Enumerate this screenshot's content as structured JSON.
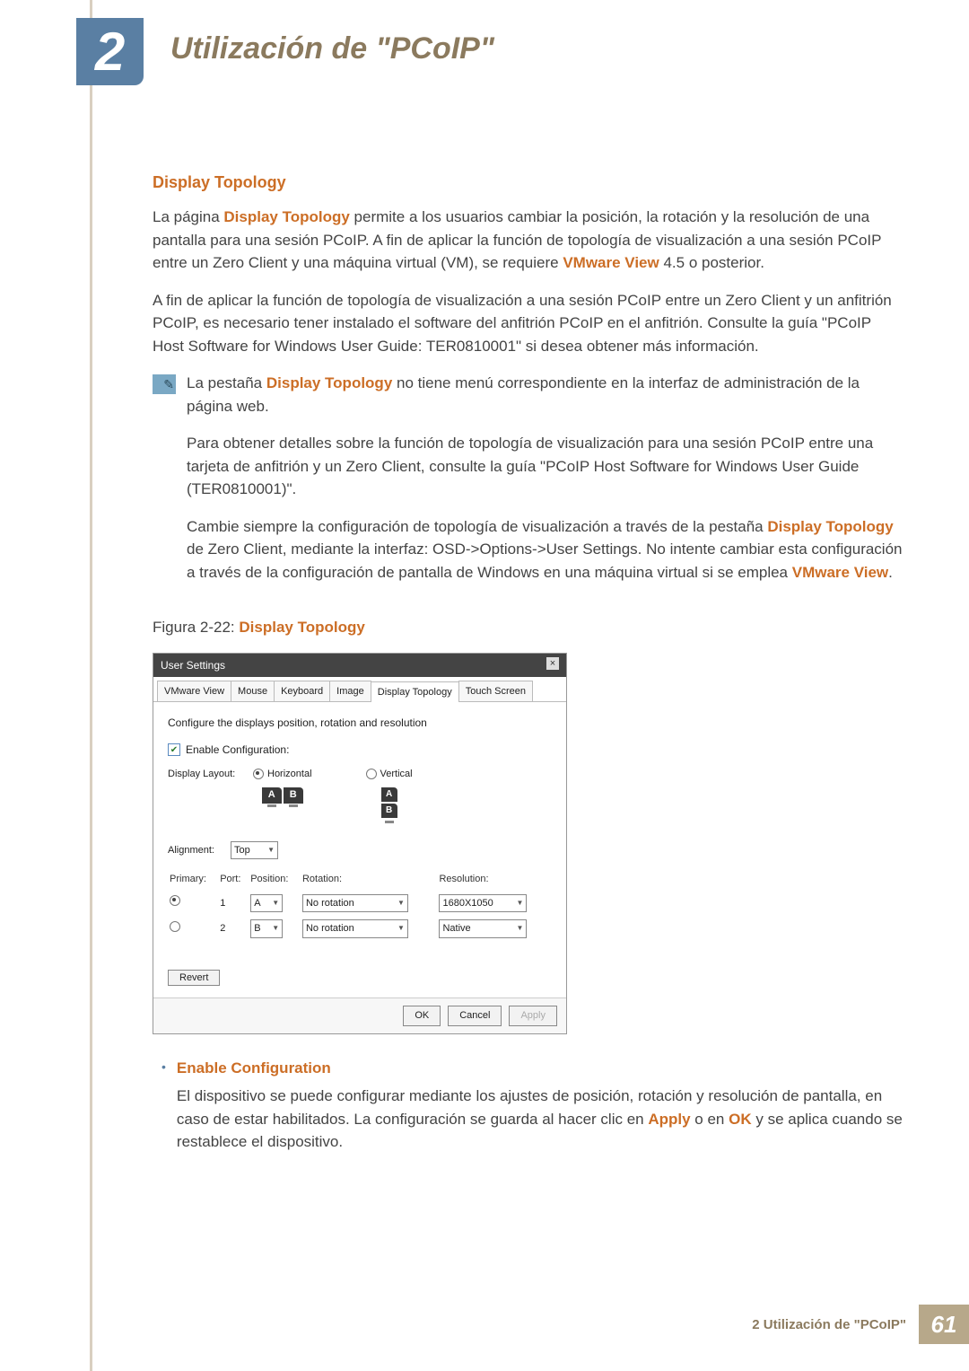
{
  "chapter": {
    "number": "2",
    "title": "Utilización de \"PCoIP\""
  },
  "section": {
    "heading": "Display Topology"
  },
  "p1": {
    "a": "La página ",
    "bold1": "Display Topology",
    "b": " permite a los usuarios cambiar la posición, la rotación y la resolución de una pantalla para una sesión PCoIP. A fin de aplicar la función de topología de visualización a una sesión PCoIP entre un Zero Client y una máquina virtual (VM), se requiere ",
    "bold2": "VMware View",
    "c": " 4.5 o posterior."
  },
  "p2": "A fin de aplicar la función de topología de visualización a una sesión PCoIP entre un Zero Client y un anfitrión PCoIP, es necesario tener instalado el software del anfitrión PCoIP en el anfitrión. Consulte la guía \"PCoIP Host Software for Windows User Guide: TER0810001\" si desea obtener más información.",
  "info1": {
    "a": "La pestaña ",
    "bold": "Display Topology",
    "b": " no tiene menú correspondiente en la interfaz de administración de la página web."
  },
  "info2": "Para obtener detalles sobre la función de topología de visualización para una sesión PCoIP entre una tarjeta de anfitrión y un Zero Client, consulte la guía \"PCoIP Host Software for Windows User Guide (TER0810001)\".",
  "info3": {
    "a": "Cambie siempre la configuración de topología de visualización a través de la pestaña ",
    "bold1": "Display Topology",
    "b": " de Zero Client, mediante la interfaz: OSD->Options->User Settings. No intente cambiar esta configuración a través de la configuración de pantalla de Windows en una máquina virtual si se emplea ",
    "bold2": "VMware View",
    "c": "."
  },
  "figure": {
    "prefix": "Figura 2-22: ",
    "name": "Display Topology"
  },
  "dialog": {
    "title": "User Settings",
    "tabs": [
      "VMware View",
      "Mouse",
      "Keyboard",
      "Image",
      "Display Topology",
      "Touch Screen"
    ],
    "active_tab_index": 4,
    "instruction": "Configure the displays position, rotation and resolution",
    "enable_label": "Enable Configuration:",
    "layout_label": "Display Layout:",
    "layout_opt_h": "Horizontal",
    "layout_opt_v": "Vertical",
    "mon_a": "A",
    "mon_b": "B",
    "align_label": "Alignment:",
    "align_value": "Top",
    "cols": {
      "primary": "Primary:",
      "port": "Port:",
      "position": "Position:",
      "rotation": "Rotation:",
      "resolution": "Resolution:"
    },
    "rows": [
      {
        "primary": true,
        "port": "1",
        "position": "A",
        "rotation": "No rotation",
        "resolution": "1680X1050"
      },
      {
        "primary": false,
        "port": "2",
        "position": "B",
        "rotation": "No rotation",
        "resolution": "Native"
      }
    ],
    "revert": "Revert",
    "ok": "OK",
    "cancel": "Cancel",
    "apply": "Apply"
  },
  "bullet": {
    "title": "Enable Configuration",
    "text_a": "El dispositivo se puede configurar mediante los ajustes de posición, rotación y resolución de pantalla, en caso de estar habilitados. La configuración se guarda al hacer clic en ",
    "bold1": "Apply",
    "text_b": " o en ",
    "bold2": "OK",
    "text_c": " y se aplica cuando se restablece el dispositivo."
  },
  "footer": {
    "label": "2 Utilización de \"PCoIP\"",
    "page": "61"
  }
}
